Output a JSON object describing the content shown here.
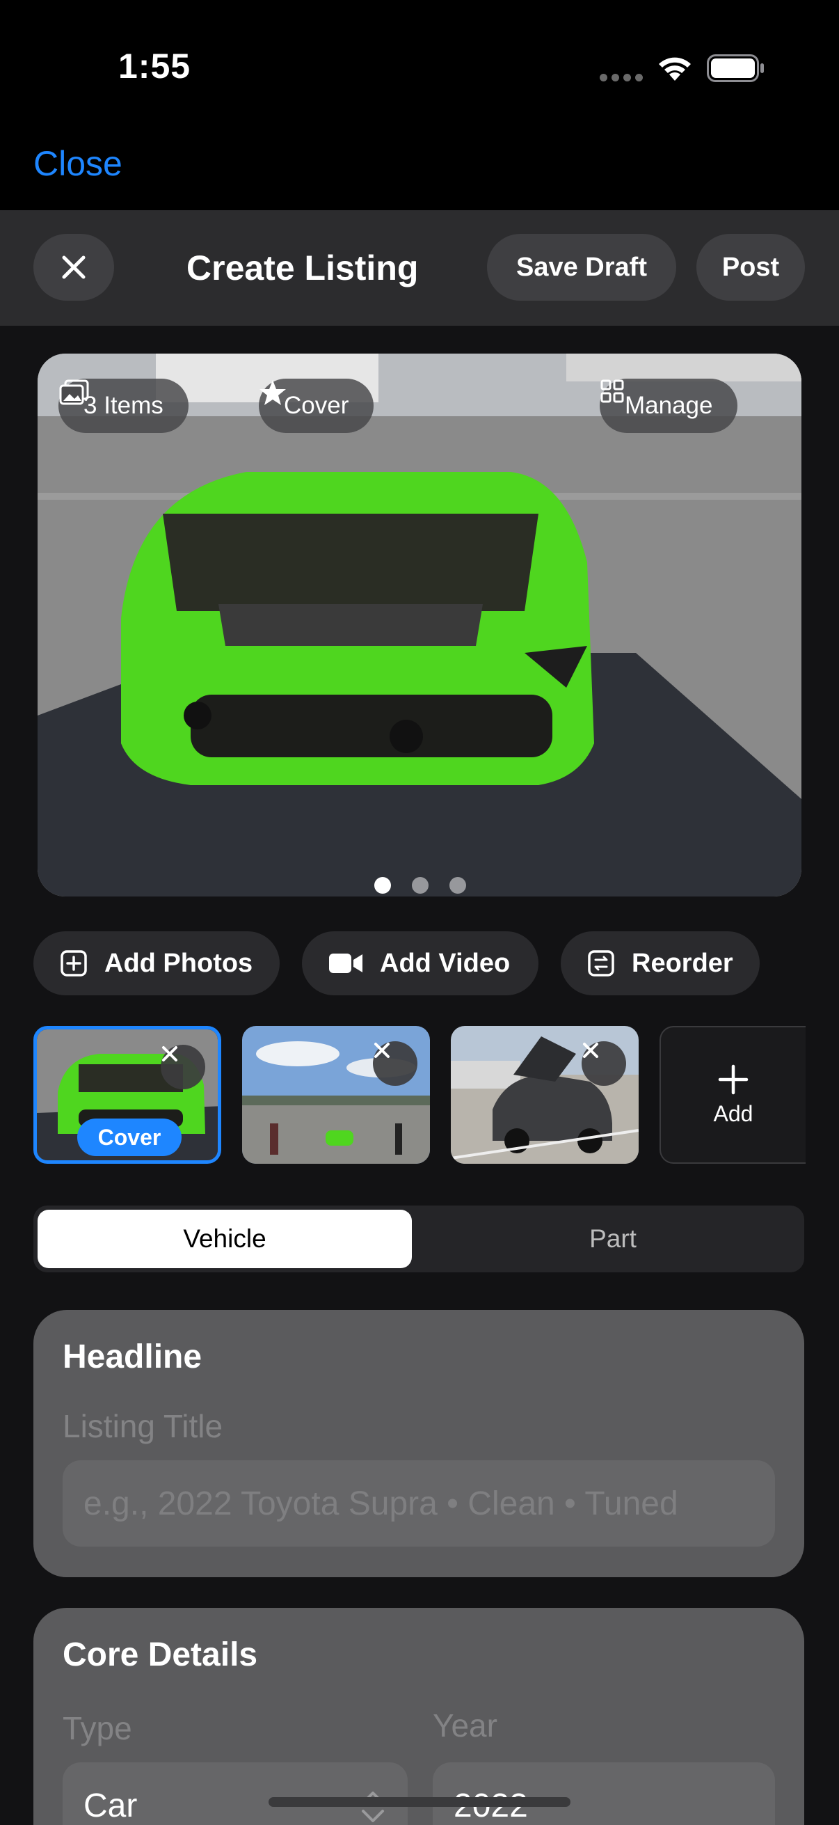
{
  "status_bar": {
    "time": "1:55"
  },
  "nav": {
    "close_label": "Close"
  },
  "header": {
    "title": "Create Listing",
    "save_draft_label": "Save Draft",
    "post_label": "Post"
  },
  "hero": {
    "items_label": "3 Items",
    "cover_label": "Cover",
    "manage_label": "Manage",
    "page_count": 3,
    "current_page": 1
  },
  "actions": {
    "add_photos": "Add Photos",
    "add_video": "Add Video",
    "reorder": "Reorder"
  },
  "thumbnails": {
    "cover_badge": "Cover",
    "add_label": "Add"
  },
  "segmented": {
    "vehicle": "Vehicle",
    "part": "Part",
    "selected": "Vehicle"
  },
  "headline": {
    "section_title": "Headline",
    "field_label": "Listing Title",
    "placeholder": "e.g., 2022 Toyota Supra • Clean • Tuned"
  },
  "core_details": {
    "section_title": "Core Details",
    "type_label": "Type",
    "type_value": "Car",
    "year_label": "Year",
    "year_value": "2022"
  },
  "colors": {
    "accent": "#1e86ff",
    "background": "#121214",
    "card": "#5b5b5d"
  }
}
